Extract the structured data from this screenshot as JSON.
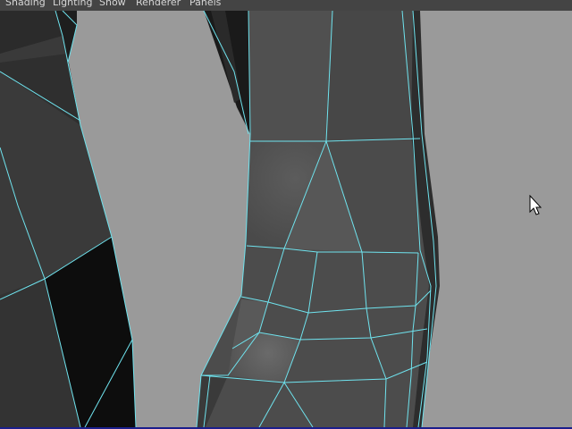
{
  "menubar": {
    "items": [
      {
        "label": "Shading"
      },
      {
        "label": "Lighting"
      },
      {
        "label": "Show"
      },
      {
        "label": "Renderer"
      },
      {
        "label": "Panels"
      }
    ]
  },
  "viewport": {
    "background_color": "#9a9a9a",
    "wireframe_color": "#6fe3ee"
  },
  "cursor": {
    "icon": "arrow-cursor-icon"
  }
}
